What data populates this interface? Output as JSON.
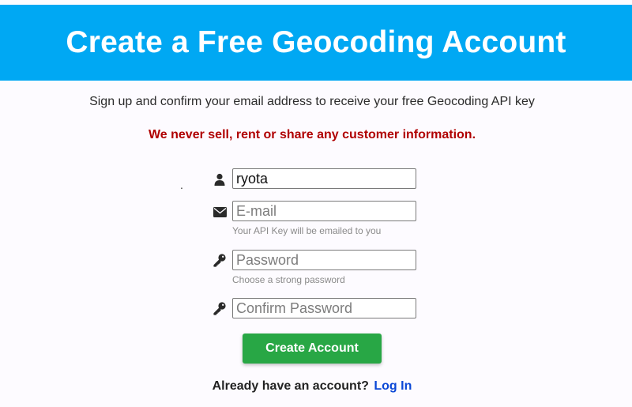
{
  "header": {
    "title": "Create a Free Geocoding Account"
  },
  "subtitle": "Sign up and confirm your email address to receive your free Geocoding API key",
  "privacy_notice": "We never sell, rent or share any customer information.",
  "form": {
    "username": {
      "value": "ryota",
      "icon": "user-icon"
    },
    "email": {
      "value": "",
      "placeholder": "E-mail",
      "hint": "Your API Key will be emailed to you",
      "icon": "envelope-icon"
    },
    "password": {
      "value": "",
      "placeholder": "Password",
      "hint": "Choose a strong password",
      "icon": "key-icon"
    },
    "confirm_password": {
      "value": "",
      "placeholder": "Confirm Password",
      "icon": "key-icon"
    },
    "submit_label": "Create Account"
  },
  "login_prompt": {
    "text": "Already have an account?",
    "link_label": "Log In"
  },
  "colors": {
    "header_bg": "#00a8f3",
    "privacy_text": "#b00000",
    "button_bg": "#28a745",
    "link": "#0a47d6"
  }
}
